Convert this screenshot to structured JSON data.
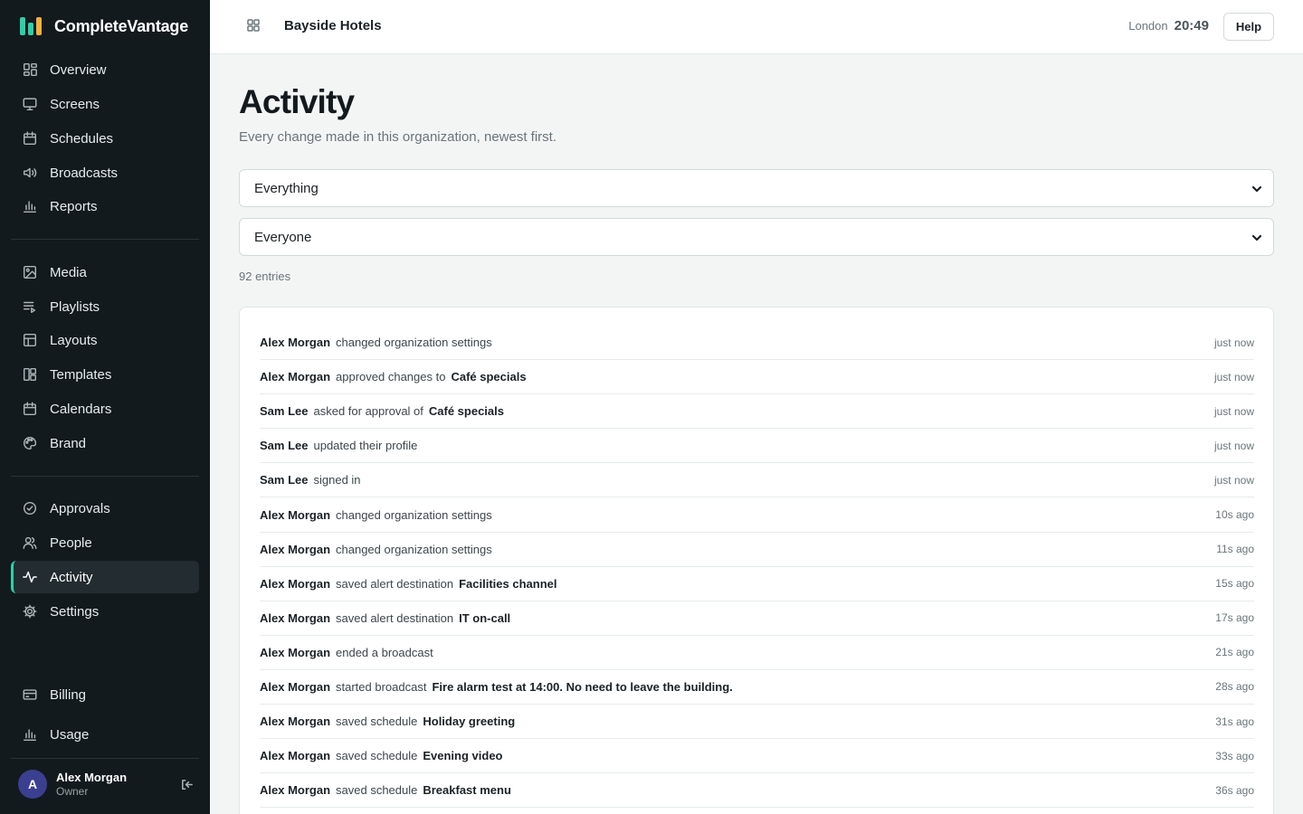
{
  "brand": {
    "name": "CompleteVantage"
  },
  "nav": {
    "group1": [
      {
        "label": "Overview",
        "icon": "overview-icon"
      },
      {
        "label": "Screens",
        "icon": "monitor-icon"
      },
      {
        "label": "Schedules",
        "icon": "calendar-icon"
      },
      {
        "label": "Broadcasts",
        "icon": "speaker-icon"
      },
      {
        "label": "Reports",
        "icon": "bar-chart-icon"
      }
    ],
    "group2": [
      {
        "label": "Media",
        "icon": "image-icon"
      },
      {
        "label": "Playlists",
        "icon": "playlist-icon"
      },
      {
        "label": "Layouts",
        "icon": "layout-icon"
      },
      {
        "label": "Templates",
        "icon": "templates-icon"
      },
      {
        "label": "Calendars",
        "icon": "calendar-icon"
      },
      {
        "label": "Brand",
        "icon": "palette-icon"
      }
    ],
    "group3": [
      {
        "label": "Approvals",
        "icon": "check-circle-icon"
      },
      {
        "label": "People",
        "icon": "people-icon"
      },
      {
        "label": "Activity",
        "icon": "activity-icon",
        "active": true
      },
      {
        "label": "Settings",
        "icon": "gear-icon"
      }
    ],
    "footer": [
      {
        "label": "Billing",
        "icon": "card-icon"
      },
      {
        "label": "Usage",
        "icon": "bar-chart-icon"
      }
    ]
  },
  "user": {
    "initial": "A",
    "name": "Alex Morgan",
    "role": "Owner"
  },
  "topbar": {
    "org_name": "Bayside Hotels",
    "clock_city": "London",
    "clock_time": "20:49",
    "help_label": "Help"
  },
  "page": {
    "title": "Activity",
    "subtitle": "Every change made in this organization, newest first.",
    "filter_type": "Everything",
    "filter_people": "Everyone",
    "entry_count": "92 entries"
  },
  "entries": [
    {
      "who": "Alex Morgan",
      "what": "changed organization settings",
      "object": "",
      "when": "just now"
    },
    {
      "who": "Alex Morgan",
      "what": "approved changes to",
      "object": "Café specials",
      "when": "just now"
    },
    {
      "who": "Sam Lee",
      "what": "asked for approval of",
      "object": "Café specials",
      "when": "just now"
    },
    {
      "who": "Sam Lee",
      "what": "updated their profile",
      "object": "",
      "when": "just now"
    },
    {
      "who": "Sam Lee",
      "what": "signed in",
      "object": "",
      "when": "just now"
    },
    {
      "who": "Alex Morgan",
      "what": "changed organization settings",
      "object": "",
      "when": "10s ago"
    },
    {
      "who": "Alex Morgan",
      "what": "changed organization settings",
      "object": "",
      "when": "11s ago"
    },
    {
      "who": "Alex Morgan",
      "what": "saved alert destination",
      "object": "Facilities channel",
      "when": "15s ago"
    },
    {
      "who": "Alex Morgan",
      "what": "saved alert destination",
      "object": "IT on-call",
      "when": "17s ago"
    },
    {
      "who": "Alex Morgan",
      "what": "ended a broadcast",
      "object": "",
      "when": "21s ago"
    },
    {
      "who": "Alex Morgan",
      "what": "started broadcast",
      "object": "Fire alarm test at 14:00. No need to leave the building.",
      "when": "28s ago"
    },
    {
      "who": "Alex Morgan",
      "what": "saved schedule",
      "object": "Holiday greeting",
      "when": "31s ago"
    },
    {
      "who": "Alex Morgan",
      "what": "saved schedule",
      "object": "Evening video",
      "when": "33s ago"
    },
    {
      "who": "Alex Morgan",
      "what": "saved schedule",
      "object": "Breakfast menu",
      "when": "36s ago"
    },
    {
      "who": "",
      "what": "",
      "object": "",
      "when": ""
    }
  ]
}
